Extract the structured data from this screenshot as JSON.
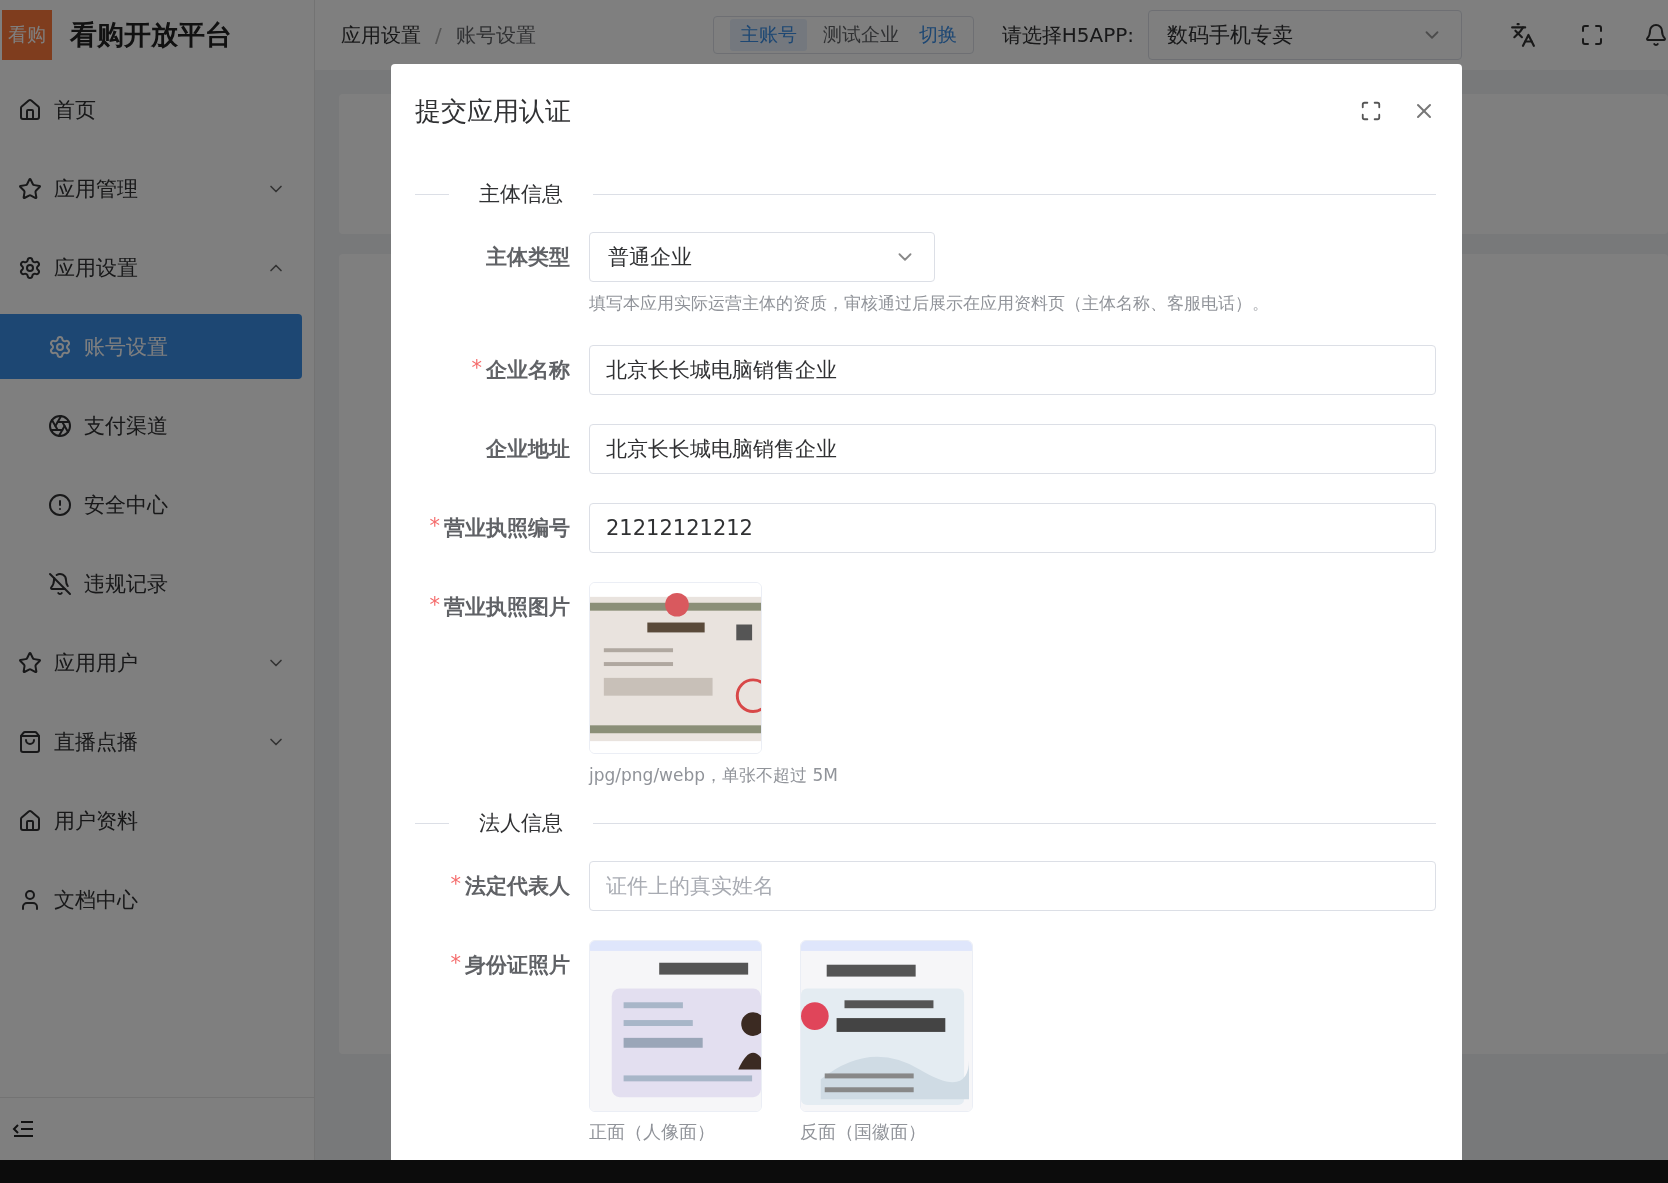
{
  "app": {
    "logo": "看购",
    "title": "看购开放平台"
  },
  "sidebar": {
    "items": [
      {
        "label": "首页",
        "selected": false
      },
      {
        "label": "应用管理",
        "selected": false,
        "expanded": false
      },
      {
        "label": "应用设置",
        "selected": false,
        "expanded": true,
        "children": [
          {
            "label": "账号设置",
            "selected": true
          },
          {
            "label": "支付渠道",
            "selected": false
          },
          {
            "label": "安全中心",
            "selected": false
          },
          {
            "label": "违规记录",
            "selected": false
          }
        ]
      },
      {
        "label": "应用用户",
        "selected": false,
        "expanded": false
      },
      {
        "label": "直播点播",
        "selected": false,
        "expanded": false
      },
      {
        "label": "用户资料",
        "selected": false
      },
      {
        "label": "文档中心",
        "selected": false
      }
    ]
  },
  "header": {
    "breadcrumb": [
      "应用设置",
      "账号设置"
    ],
    "separator": "/",
    "account_switch": {
      "options": [
        {
          "label": "主账号",
          "selected": true
        },
        {
          "label": "测试企业",
          "selected": false
        }
      ],
      "action": "切换"
    },
    "app_select": {
      "label": "请选择H5APP:",
      "value": "数码手机专卖"
    }
  },
  "modal": {
    "title": "提交应用认证",
    "required_mark": "*",
    "sections": [
      {
        "title": "主体信息",
        "fields": [
          {
            "kind": "select",
            "label": "主体类型",
            "required": false,
            "value": "普通企业",
            "hint": "填写本应用实际运营主体的资质，审核通过后展示在应用资料页（主体名称、客服电话）。"
          },
          {
            "kind": "text",
            "label": "企业名称",
            "required": true,
            "value": "北京长长城电脑销售企业"
          },
          {
            "kind": "text",
            "label": "企业地址",
            "required": false,
            "value": "北京长长城电脑销售企业"
          },
          {
            "kind": "text",
            "label": "营业执照编号",
            "required": true,
            "value": "21212121212"
          },
          {
            "kind": "upload",
            "label": "营业执照图片",
            "required": true,
            "hint": "jpg/png/webp，单张不超过 5M"
          }
        ]
      },
      {
        "title": "法人信息",
        "fields": [
          {
            "kind": "text",
            "label": "法定代表人",
            "required": true,
            "placeholder": "证件上的真实姓名"
          },
          {
            "kind": "upload",
            "label": "身份证照片",
            "required": true,
            "images": [
              {
                "kind": "picture",
                "caption": "正面（人像面）"
              },
              {
                "kind": "picture",
                "caption": "反面（国徽面）"
              }
            ]
          }
        ]
      }
    ]
  }
}
